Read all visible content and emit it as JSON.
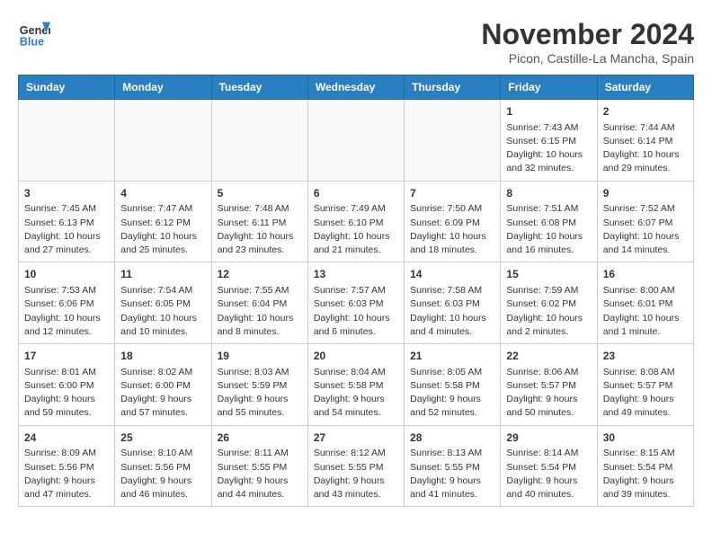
{
  "header": {
    "logo_line1": "General",
    "logo_line2": "Blue",
    "month_title": "November 2024",
    "location": "Picon, Castille-La Mancha, Spain"
  },
  "weekdays": [
    "Sunday",
    "Monday",
    "Tuesday",
    "Wednesday",
    "Thursday",
    "Friday",
    "Saturday"
  ],
  "weeks": [
    [
      {
        "day": "",
        "info": ""
      },
      {
        "day": "",
        "info": ""
      },
      {
        "day": "",
        "info": ""
      },
      {
        "day": "",
        "info": ""
      },
      {
        "day": "",
        "info": ""
      },
      {
        "day": "1",
        "info": "Sunrise: 7:43 AM\nSunset: 6:15 PM\nDaylight: 10 hours and 32 minutes."
      },
      {
        "day": "2",
        "info": "Sunrise: 7:44 AM\nSunset: 6:14 PM\nDaylight: 10 hours and 29 minutes."
      }
    ],
    [
      {
        "day": "3",
        "info": "Sunrise: 7:45 AM\nSunset: 6:13 PM\nDaylight: 10 hours and 27 minutes."
      },
      {
        "day": "4",
        "info": "Sunrise: 7:47 AM\nSunset: 6:12 PM\nDaylight: 10 hours and 25 minutes."
      },
      {
        "day": "5",
        "info": "Sunrise: 7:48 AM\nSunset: 6:11 PM\nDaylight: 10 hours and 23 minutes."
      },
      {
        "day": "6",
        "info": "Sunrise: 7:49 AM\nSunset: 6:10 PM\nDaylight: 10 hours and 21 minutes."
      },
      {
        "day": "7",
        "info": "Sunrise: 7:50 AM\nSunset: 6:09 PM\nDaylight: 10 hours and 18 minutes."
      },
      {
        "day": "8",
        "info": "Sunrise: 7:51 AM\nSunset: 6:08 PM\nDaylight: 10 hours and 16 minutes."
      },
      {
        "day": "9",
        "info": "Sunrise: 7:52 AM\nSunset: 6:07 PM\nDaylight: 10 hours and 14 minutes."
      }
    ],
    [
      {
        "day": "10",
        "info": "Sunrise: 7:53 AM\nSunset: 6:06 PM\nDaylight: 10 hours and 12 minutes."
      },
      {
        "day": "11",
        "info": "Sunrise: 7:54 AM\nSunset: 6:05 PM\nDaylight: 10 hours and 10 minutes."
      },
      {
        "day": "12",
        "info": "Sunrise: 7:55 AM\nSunset: 6:04 PM\nDaylight: 10 hours and 8 minutes."
      },
      {
        "day": "13",
        "info": "Sunrise: 7:57 AM\nSunset: 6:03 PM\nDaylight: 10 hours and 6 minutes."
      },
      {
        "day": "14",
        "info": "Sunrise: 7:58 AM\nSunset: 6:03 PM\nDaylight: 10 hours and 4 minutes."
      },
      {
        "day": "15",
        "info": "Sunrise: 7:59 AM\nSunset: 6:02 PM\nDaylight: 10 hours and 2 minutes."
      },
      {
        "day": "16",
        "info": "Sunrise: 8:00 AM\nSunset: 6:01 PM\nDaylight: 10 hours and 1 minute."
      }
    ],
    [
      {
        "day": "17",
        "info": "Sunrise: 8:01 AM\nSunset: 6:00 PM\nDaylight: 9 hours and 59 minutes."
      },
      {
        "day": "18",
        "info": "Sunrise: 8:02 AM\nSunset: 6:00 PM\nDaylight: 9 hours and 57 minutes."
      },
      {
        "day": "19",
        "info": "Sunrise: 8:03 AM\nSunset: 5:59 PM\nDaylight: 9 hours and 55 minutes."
      },
      {
        "day": "20",
        "info": "Sunrise: 8:04 AM\nSunset: 5:58 PM\nDaylight: 9 hours and 54 minutes."
      },
      {
        "day": "21",
        "info": "Sunrise: 8:05 AM\nSunset: 5:58 PM\nDaylight: 9 hours and 52 minutes."
      },
      {
        "day": "22",
        "info": "Sunrise: 8:06 AM\nSunset: 5:57 PM\nDaylight: 9 hours and 50 minutes."
      },
      {
        "day": "23",
        "info": "Sunrise: 8:08 AM\nSunset: 5:57 PM\nDaylight: 9 hours and 49 minutes."
      }
    ],
    [
      {
        "day": "24",
        "info": "Sunrise: 8:09 AM\nSunset: 5:56 PM\nDaylight: 9 hours and 47 minutes."
      },
      {
        "day": "25",
        "info": "Sunrise: 8:10 AM\nSunset: 5:56 PM\nDaylight: 9 hours and 46 minutes."
      },
      {
        "day": "26",
        "info": "Sunrise: 8:11 AM\nSunset: 5:55 PM\nDaylight: 9 hours and 44 minutes."
      },
      {
        "day": "27",
        "info": "Sunrise: 8:12 AM\nSunset: 5:55 PM\nDaylight: 9 hours and 43 minutes."
      },
      {
        "day": "28",
        "info": "Sunrise: 8:13 AM\nSunset: 5:55 PM\nDaylight: 9 hours and 41 minutes."
      },
      {
        "day": "29",
        "info": "Sunrise: 8:14 AM\nSunset: 5:54 PM\nDaylight: 9 hours and 40 minutes."
      },
      {
        "day": "30",
        "info": "Sunrise: 8:15 AM\nSunset: 5:54 PM\nDaylight: 9 hours and 39 minutes."
      }
    ]
  ]
}
